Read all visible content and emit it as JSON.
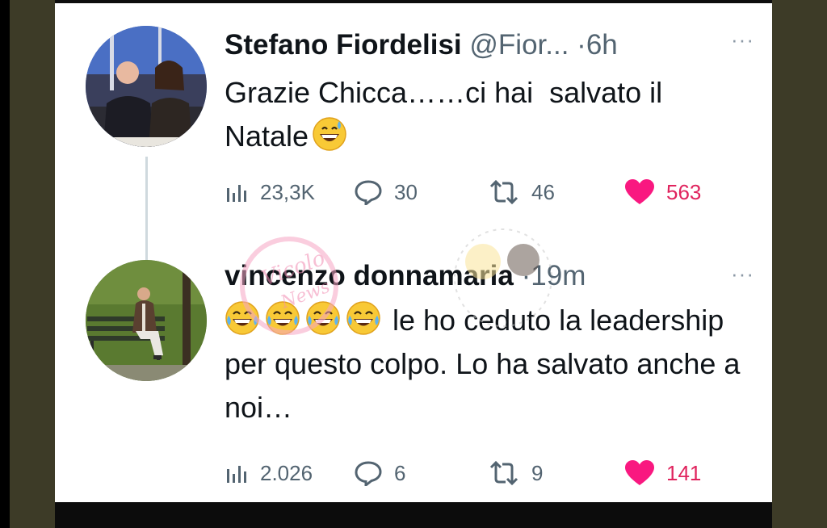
{
  "colors": {
    "background_frame": "#3d3b27",
    "card": "#ffffff",
    "text_primary": "#0f1419",
    "text_secondary": "#536471",
    "like_pink": "#e0245e",
    "thread_line": "#cfd9de"
  },
  "tweets": [
    {
      "name": "Stefano Fiordelisi",
      "handle": "@Fior...",
      "separator": "·",
      "time": "6h",
      "more": "···",
      "text": "Grazie Chicca……ci hai  salvato il Natale",
      "emoji": "grinning-sweat-emoji",
      "stats": {
        "views": "23,3K",
        "replies": "30",
        "retweets": "46",
        "likes": "563"
      },
      "avatar": "avatar-couple-photo"
    },
    {
      "name": "vincenzo donnamaria",
      "separator": "·",
      "time": "19m",
      "more": "···",
      "emojis": [
        "joy-emoji",
        "joy-emoji",
        "joy-emoji",
        "joy-emoji"
      ],
      "text": "le ho ceduto la leadership per questo colpo. Lo ha salvato anche a noi…",
      "stats": {
        "views": "2.026",
        "replies": "6",
        "retweets": "9",
        "likes": "141"
      },
      "avatar": "avatar-man-on-bench-photo"
    }
  ],
  "watermark": {
    "text": "Vicolo News"
  }
}
